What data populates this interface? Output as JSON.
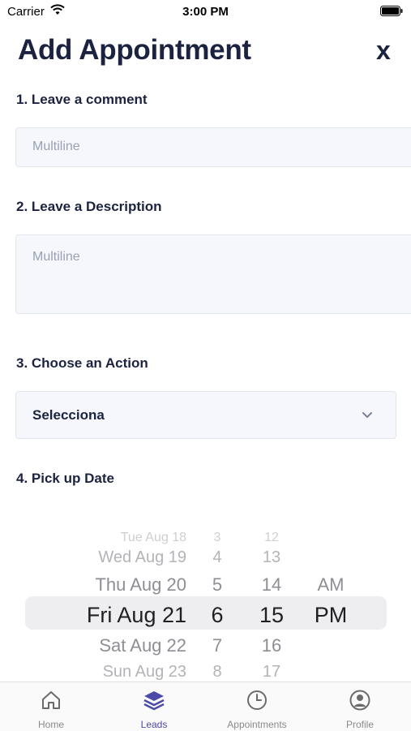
{
  "status_bar": {
    "carrier": "Carrier",
    "time": "3:00 PM"
  },
  "header": {
    "title": "Add Appointment",
    "close_label": "x"
  },
  "form": {
    "comment": {
      "label": "1. Leave a comment",
      "placeholder": "Multiline"
    },
    "description": {
      "label": "2. Leave a Description",
      "placeholder": "Multiline"
    },
    "action": {
      "label": "3. Choose an Action",
      "selected": "Selecciona"
    },
    "date": {
      "label": "4. Pick up Date"
    }
  },
  "date_picker": {
    "rows": [
      {
        "date": "Tue Aug 18",
        "hour": "3",
        "minute": "12",
        "ampm": ""
      },
      {
        "date": "Wed Aug 19",
        "hour": "4",
        "minute": "13",
        "ampm": ""
      },
      {
        "date": "Thu Aug 20",
        "hour": "5",
        "minute": "14",
        "ampm": "AM"
      },
      {
        "date": "Fri Aug 21",
        "hour": "6",
        "minute": "15",
        "ampm": "PM"
      },
      {
        "date": "Sat Aug 22",
        "hour": "7",
        "minute": "16",
        "ampm": ""
      },
      {
        "date": "Sun Aug 23",
        "hour": "8",
        "minute": "17",
        "ampm": ""
      }
    ],
    "selected_index": 3
  },
  "tabs": [
    {
      "label": "Home",
      "icon": "home-icon",
      "active": false
    },
    {
      "label": "Leads",
      "icon": "layers-icon",
      "active": true
    },
    {
      "label": "Appointments",
      "icon": "clock-icon",
      "active": false
    },
    {
      "label": "Profile",
      "icon": "profile-icon",
      "active": false
    }
  ],
  "colors": {
    "primary_text": "#1c2340",
    "active_tab": "#4b4aa8",
    "field_bg": "#f5f7fc"
  }
}
